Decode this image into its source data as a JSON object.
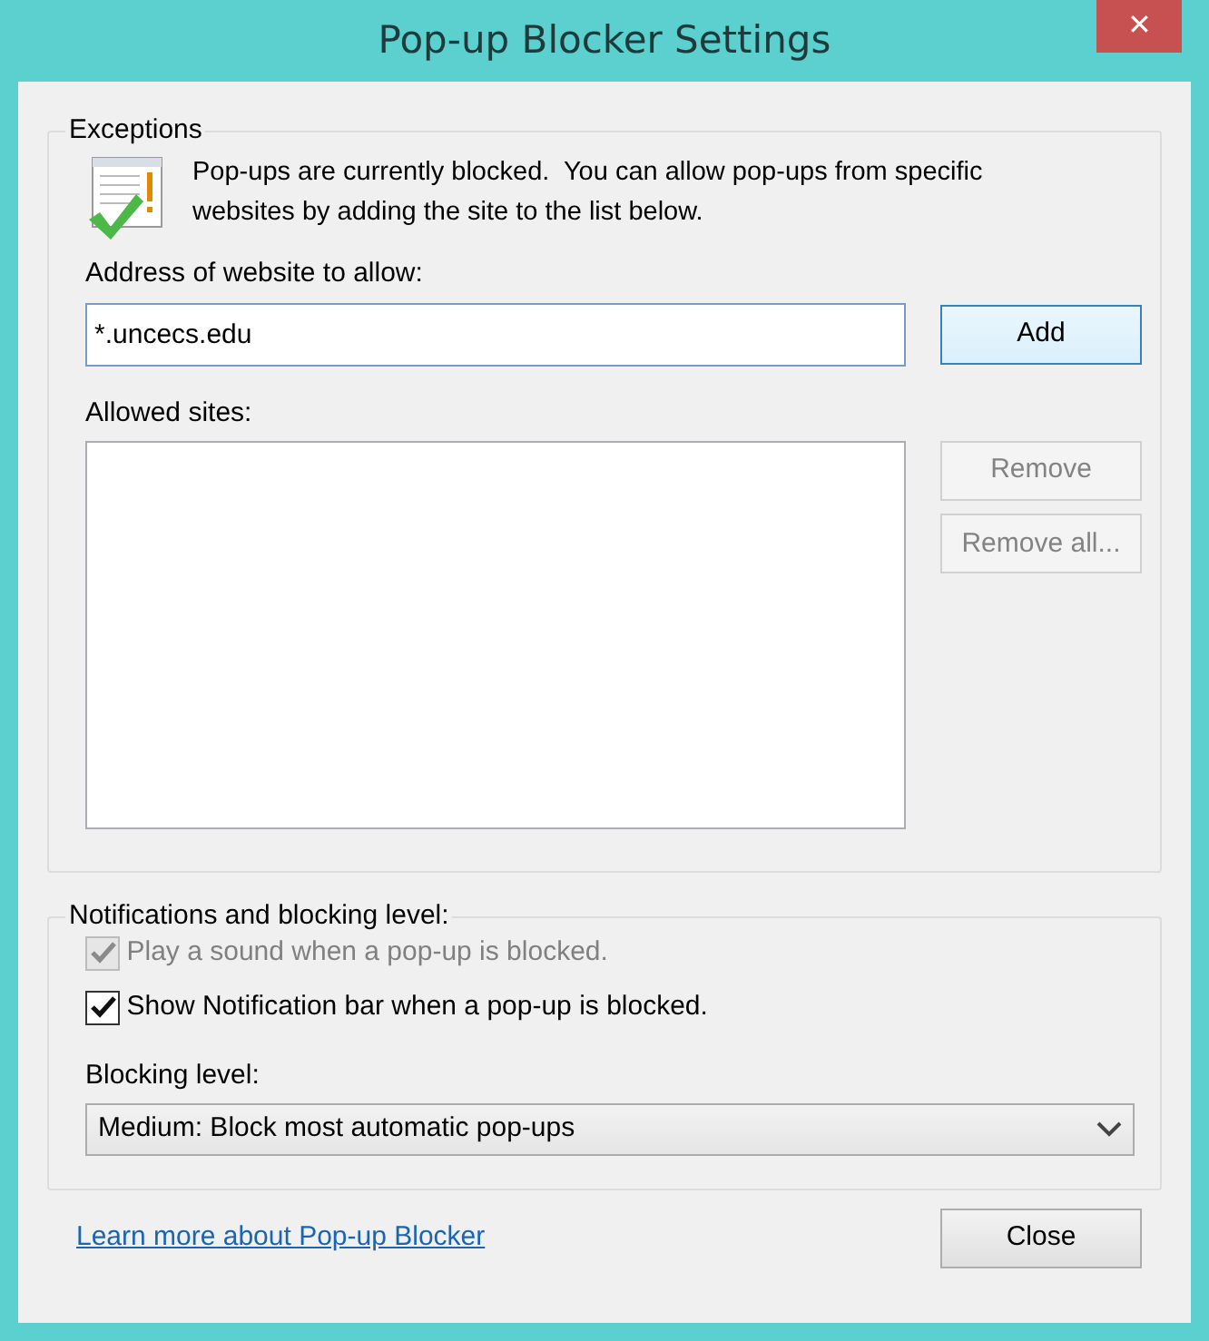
{
  "window": {
    "title": "Pop-up Blocker Settings",
    "close": "✕"
  },
  "exceptions": {
    "heading": "Exceptions",
    "message": "Pop-ups are currently blocked.  You can allow pop-ups from specific websites by adding the site to the list below.",
    "address_label": "Address of website to allow:",
    "address_value": "*.uncecs.edu",
    "add_button": {
      "label": "Add",
      "disabled": false,
      "focused": true
    },
    "allowed_label": "Allowed sites:",
    "side_buttons": [
      {
        "label": "Remove",
        "disabled": true
      },
      {
        "label": "Remove all...",
        "disabled": true
      }
    ]
  },
  "notifications": {
    "heading": "Notifications and blocking level:",
    "options": [
      {
        "label": "Play a sound when a pop-up is blocked.",
        "checked": true,
        "disabled": true
      },
      {
        "label": "Show Notification bar when a pop-up is blocked.",
        "checked": true,
        "disabled": false
      }
    ],
    "level_label": "Blocking level:",
    "level_value": "Medium: Block most automatic pop-ups"
  },
  "footer": {
    "link": "Learn more about Pop-up Blocker",
    "close_button": "Close"
  }
}
